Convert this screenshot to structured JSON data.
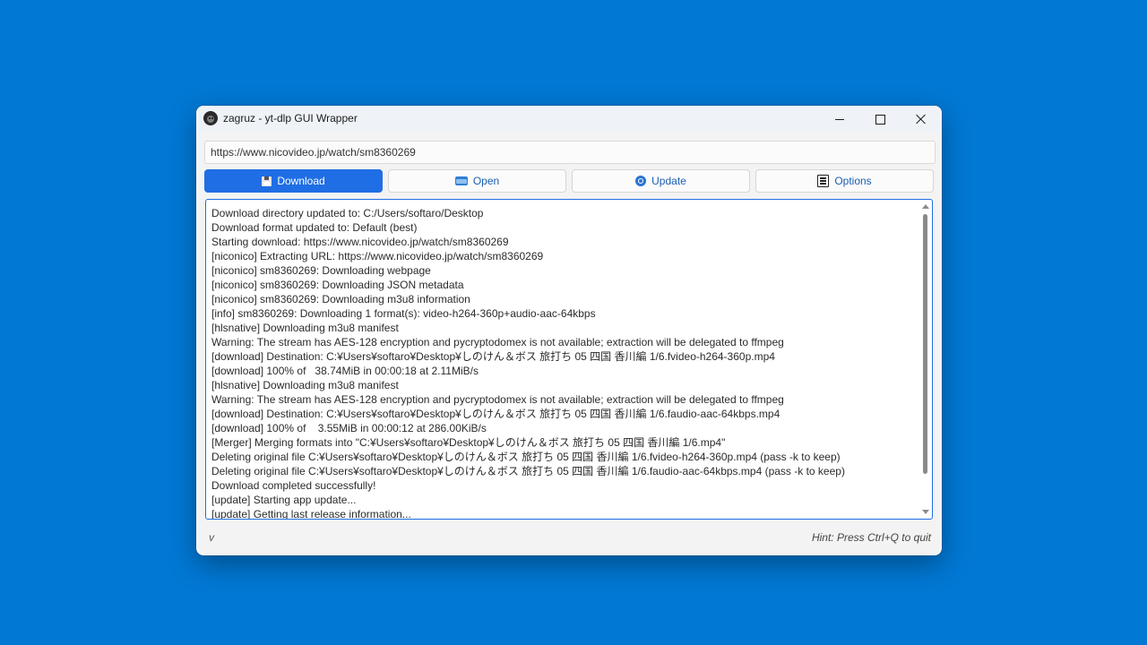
{
  "window": {
    "title": "zagruz - yt-dlp GUI Wrapper"
  },
  "url_input": {
    "value": "https://www.nicovideo.jp/watch/sm8360269"
  },
  "buttons": {
    "download": "Download",
    "open": "Open",
    "update": "Update",
    "options": "Options"
  },
  "log": [
    "Download directory updated to: C:/Users/softaro/Desktop",
    "Download format updated to: Default (best)",
    "Starting download: https://www.nicovideo.jp/watch/sm8360269",
    "[niconico] Extracting URL: https://www.nicovideo.jp/watch/sm8360269",
    "[niconico] sm8360269: Downloading webpage",
    "[niconico] sm8360269: Downloading JSON metadata",
    "[niconico] sm8360269: Downloading m3u8 information",
    "[info] sm8360269: Downloading 1 format(s): video-h264-360p+audio-aac-64kbps",
    "[hlsnative] Downloading m3u8 manifest",
    "Warning: The stream has AES-128 encryption and pycryptodomex is not available; extraction will be delegated to ffmpeg",
    "[download] Destination: C:¥Users¥softaro¥Desktop¥しのけん＆ボス 旅打ち 05 四国 香川編 1/6.fvideo-h264-360p.mp4",
    "[download] 100% of   38.74MiB in 00:00:18 at 2.11MiB/s",
    "[hlsnative] Downloading m3u8 manifest",
    "Warning: The stream has AES-128 encryption and pycryptodomex is not available; extraction will be delegated to ffmpeg",
    "[download] Destination: C:¥Users¥softaro¥Desktop¥しのけん＆ボス 旅打ち 05 四国 香川編 1/6.faudio-aac-64kbps.mp4",
    "[download] 100% of    3.55MiB in 00:00:12 at 286.00KiB/s",
    "[Merger] Merging formats into \"C:¥Users¥softaro¥Desktop¥しのけん＆ボス 旅打ち 05 四国 香川編 1/6.mp4\"",
    "Deleting original file C:¥Users¥softaro¥Desktop¥しのけん＆ボス 旅打ち 05 四国 香川編 1/6.fvideo-h264-360p.mp4 (pass -k to keep)",
    "Deleting original file C:¥Users¥softaro¥Desktop¥しのけん＆ボス 旅打ち 05 四国 香川編 1/6.faudio-aac-64kbps.mp4 (pass -k to keep)",
    "Download completed successfully!",
    "[update] Starting app update...",
    "[update] Getting last release information..."
  ],
  "status": {
    "version": "v",
    "hint": "Hint: Press Ctrl+Q to quit"
  }
}
